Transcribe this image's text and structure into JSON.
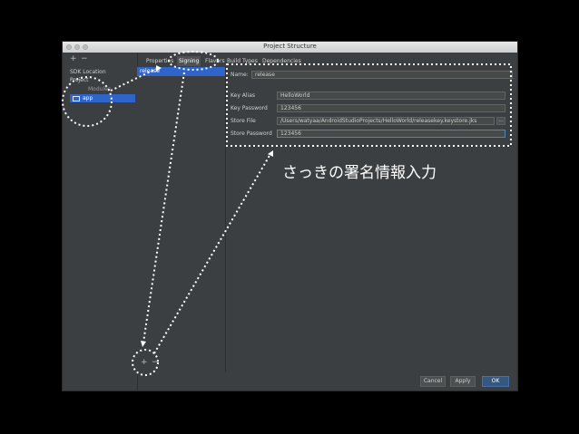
{
  "window": {
    "title": "Project Structure"
  },
  "toolbar": {
    "add": "+",
    "remove": "−"
  },
  "sidebar": {
    "sdk_location": "SDK Location",
    "project": "Project",
    "modules_header": "Modules",
    "module_app": "app"
  },
  "tabs": [
    {
      "label": "Properties"
    },
    {
      "label": "Signing"
    },
    {
      "label": "Flavors"
    },
    {
      "label": "Build Types"
    },
    {
      "label": "Dependencies"
    }
  ],
  "config_list": {
    "selected": "release",
    "add": "+",
    "remove": "−"
  },
  "form": {
    "name": {
      "label": "Name:",
      "value": "release"
    },
    "key_alias": {
      "label": "Key Alias",
      "value": "HelloWorld"
    },
    "key_password": {
      "label": "Key Password",
      "value": "123456"
    },
    "store_file": {
      "label": "Store File",
      "value": "/Users/watyaa/AndroidStudioProjects/HelloWorld/releasekey.keystore.jks",
      "browse": "..."
    },
    "store_password": {
      "label": "Store Password",
      "value": "123456"
    }
  },
  "buttons": {
    "cancel": "Cancel",
    "apply": "Apply",
    "ok": "OK"
  },
  "annotation": {
    "text": "さっきの署名情報入力"
  }
}
